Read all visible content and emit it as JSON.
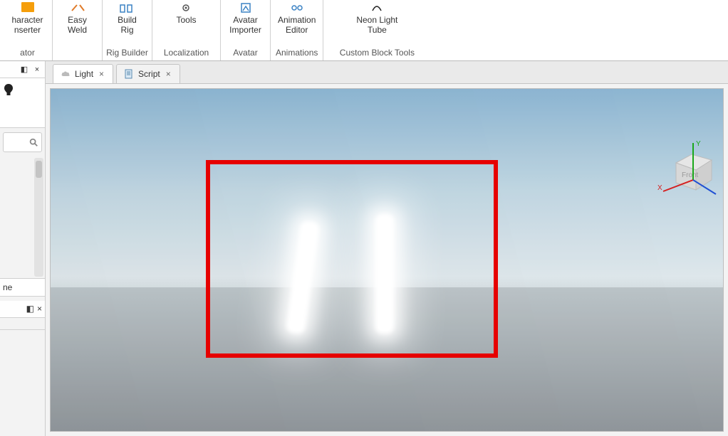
{
  "ribbon": {
    "groups": [
      {
        "group_label": "ator",
        "items": [
          {
            "line1": "haracter",
            "line2": "nserter",
            "icon": "orange-square"
          }
        ]
      },
      {
        "group_label": "",
        "items": [
          {
            "line1": "Easy",
            "line2": "Weld",
            "icon": "weld"
          }
        ]
      },
      {
        "group_label": "Rig Builder",
        "items": [
          {
            "line1": "Build",
            "line2": "Rig",
            "icon": "rig"
          }
        ]
      },
      {
        "group_label": "Localization",
        "items": [
          {
            "line1": "Tools",
            "line2": "",
            "icon": "gear"
          }
        ]
      },
      {
        "group_label": "Avatar",
        "items": [
          {
            "line1": "Avatar",
            "line2": "Importer",
            "icon": "avatar"
          }
        ]
      },
      {
        "group_label": "Animations",
        "items": [
          {
            "line1": "Animation",
            "line2": "Editor",
            "icon": "anim"
          }
        ]
      },
      {
        "group_label": "Custom Block Tools",
        "items": [
          {
            "line1": "Neon Light",
            "line2": "Tube",
            "icon": "neon"
          }
        ]
      }
    ]
  },
  "tabs": [
    {
      "label": "Light",
      "icon": "cloud",
      "active": true
    },
    {
      "label": "Script",
      "icon": "script",
      "active": false
    }
  ],
  "left_panels": {
    "hdr_pin": "⇱",
    "hdr_close": "×",
    "row_ne": "ne"
  },
  "gizmo": {
    "x": "X",
    "y": "Y",
    "front": "Front"
  }
}
